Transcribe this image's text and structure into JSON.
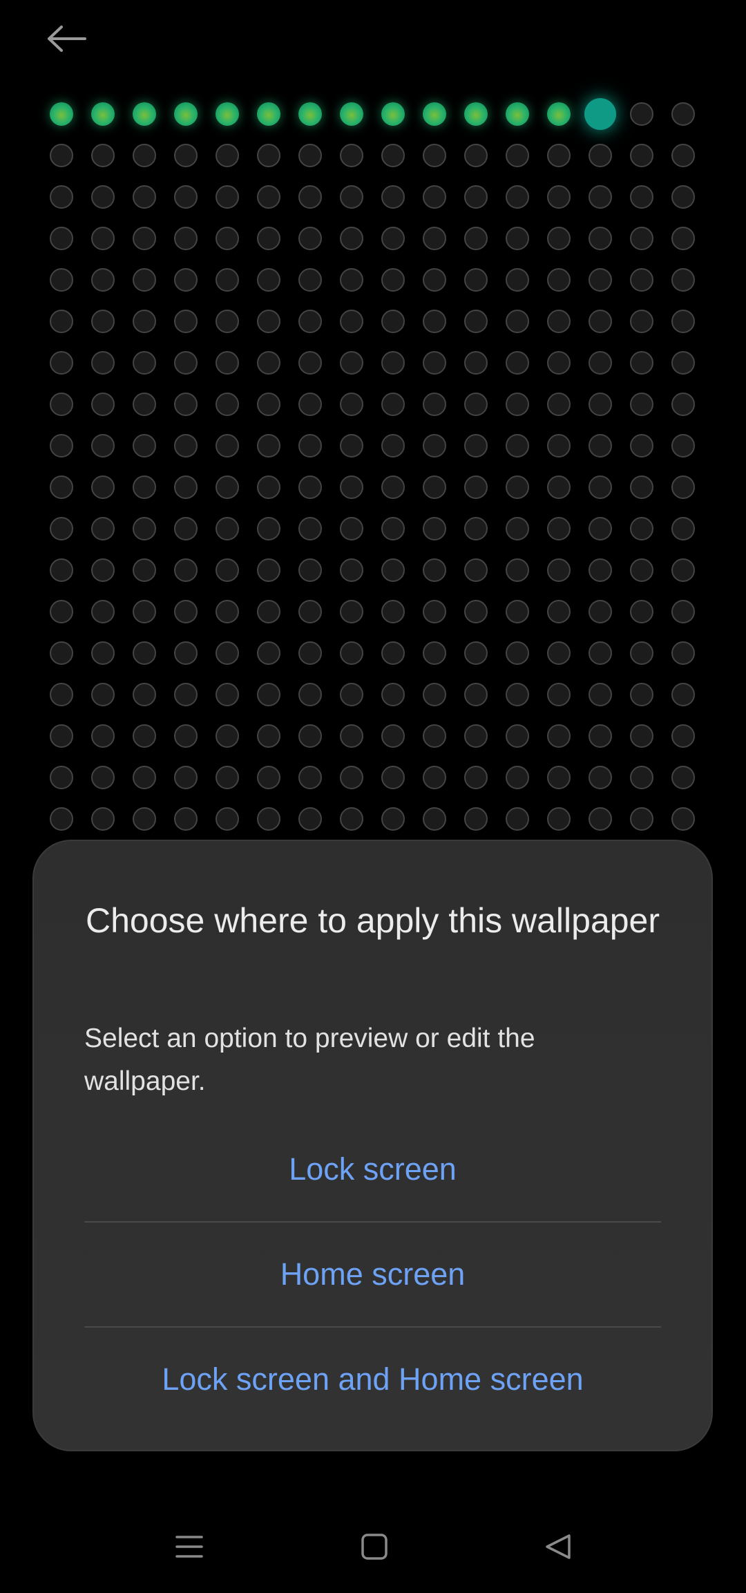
{
  "top_bar": {
    "back_icon": "arrow-left-icon"
  },
  "wallpaper_preview": {
    "columns": 16,
    "rows": 18,
    "lit_count": 13,
    "head_index": 13,
    "colors": {
      "dot_border": "#444444",
      "dot_fill": "#1c1c1c",
      "lit_green": "#2bb36a",
      "head_teal": "#0f9a86"
    }
  },
  "dialog": {
    "title": "Choose where to apply this wallpaper",
    "description": "Select an option to preview or edit the wallpaper.",
    "options": [
      {
        "label": "Lock screen"
      },
      {
        "label": "Home screen"
      },
      {
        "label": "Lock screen and Home screen"
      }
    ],
    "accent_color": "#6ea2f5"
  },
  "nav_bar": {
    "menu_icon": "menu-icon",
    "home_icon": "home-icon",
    "back_icon": "triangle-back-icon"
  }
}
